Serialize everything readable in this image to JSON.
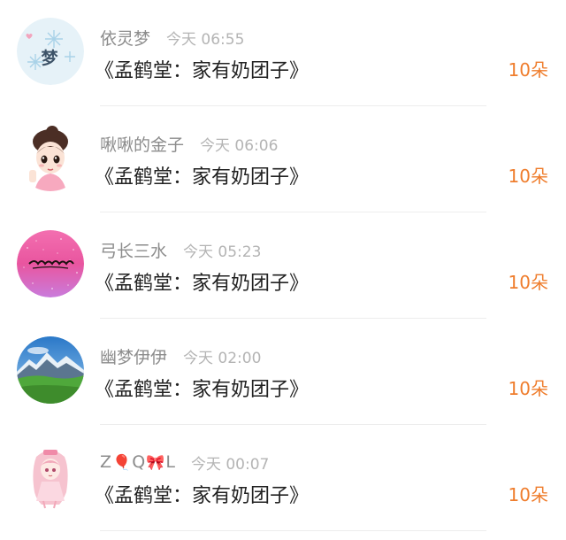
{
  "gift_list": [
    {
      "avatar_icon": "avatar-snowflake-meng",
      "avatar_text": "梦",
      "name": "依灵梦",
      "time": "今天 06:55",
      "title": "《孟鹤堂：家有奶团子》",
      "count": "10朵"
    },
    {
      "avatar_icon": "avatar-cartoon-girl",
      "name": "啾啾的金子",
      "time": "今天 06:06",
      "title": "《孟鹤堂：家有奶团子》",
      "count": "10朵"
    },
    {
      "avatar_icon": "avatar-pink-glitter",
      "name": "弓长三水",
      "time": "今天 05:23",
      "title": "《孟鹤堂：家有奶团子》",
      "count": "10朵"
    },
    {
      "avatar_icon": "avatar-mountain-landscape",
      "name": "幽梦伊伊",
      "time": "今天 02:00",
      "title": "《孟鹤堂：家有奶团子》",
      "count": "10朵"
    },
    {
      "avatar_icon": "avatar-anime-girl-pink",
      "name_parts": [
        "Z",
        "🎈",
        "Q",
        "🎀",
        "L"
      ],
      "time": "今天 00:07",
      "title": "《孟鹤堂：家有奶团子》",
      "count": "10朵"
    }
  ],
  "colors": {
    "count": "#ef7d2d",
    "name": "#8c8c8c",
    "time": "#b4b4b4",
    "title": "#222222"
  }
}
